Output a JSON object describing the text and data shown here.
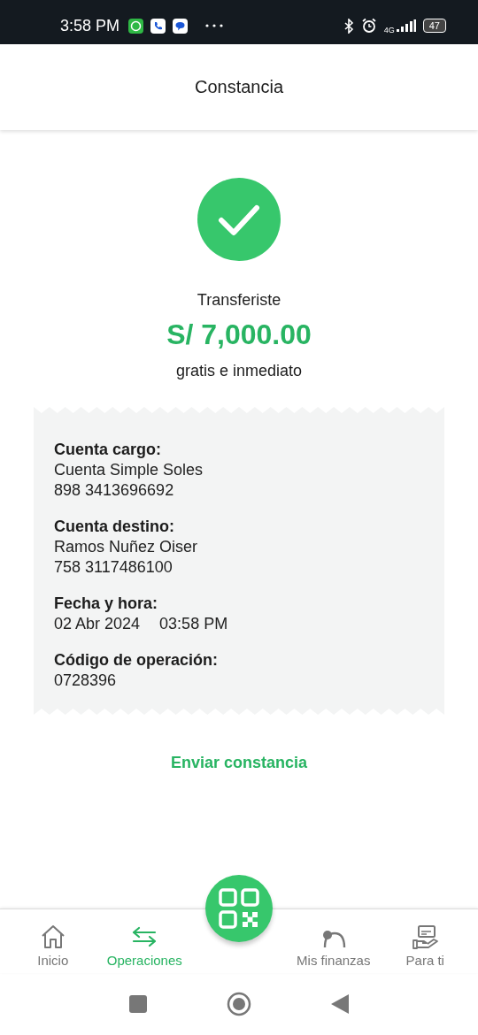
{
  "status_bar": {
    "time": "3:58 PM",
    "network": "4G",
    "battery": "47"
  },
  "header": {
    "title": "Constancia"
  },
  "result": {
    "label": "Transferiste",
    "amount": "S/ 7,000.00",
    "note": "gratis e inmediato"
  },
  "details": [
    {
      "label": "Cuenta cargo:",
      "lines": [
        [
          "Cuenta Simple Soles"
        ],
        [
          "898 3413696692"
        ]
      ]
    },
    {
      "label": "Cuenta destino:",
      "lines": [
        [
          "Ramos Nuñez Oiser"
        ],
        [
          "758 3117486100"
        ]
      ]
    },
    {
      "label": "Fecha y hora:",
      "lines": [
        [
          "02 Abr 2024",
          "03:58 PM"
        ]
      ]
    },
    {
      "label": "Código de operación:",
      "lines": [
        [
          "0728396"
        ]
      ]
    }
  ],
  "send_link": "Enviar constancia",
  "bottom_nav": [
    {
      "label": "Inicio",
      "selected": false
    },
    {
      "label": "Operaciones",
      "selected": true
    },
    {
      "label": "Mis finanzas",
      "selected": false
    },
    {
      "label": "Para ti",
      "selected": false
    }
  ]
}
